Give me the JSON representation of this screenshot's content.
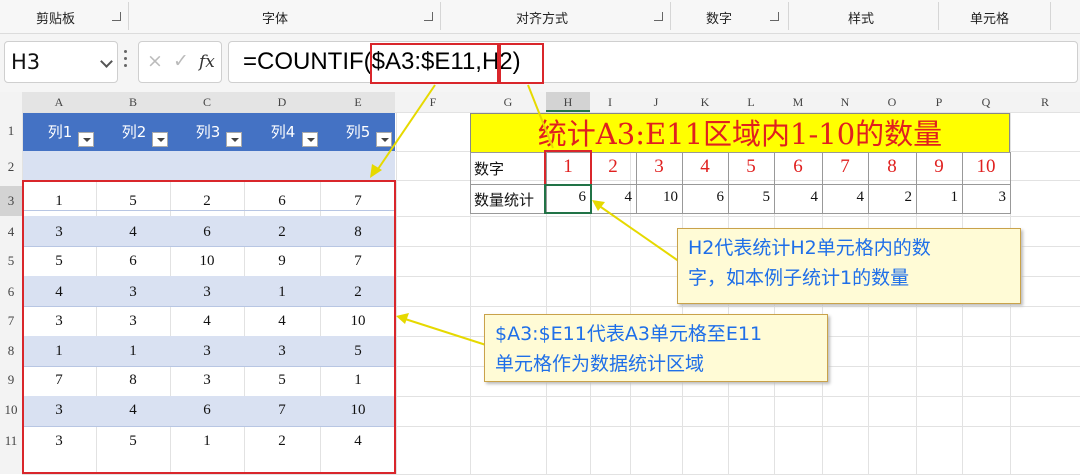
{
  "ribbon": {
    "groups": [
      "剪贴板",
      "字体",
      "对齐方式",
      "数字",
      "样式",
      "单元格"
    ]
  },
  "formula_bar": {
    "name_box": "H3",
    "cancel_icon": "×",
    "confirm_icon": "✓",
    "fx_label": "fx",
    "formula": "=COUNTIF($A3:$E11,H2)"
  },
  "columns": [
    "A",
    "B",
    "C",
    "D",
    "E",
    "F",
    "G",
    "H",
    "I",
    "J",
    "K",
    "L",
    "M",
    "N",
    "O",
    "P",
    "Q",
    "R"
  ],
  "rows": [
    "1",
    "2",
    "3",
    "4",
    "5",
    "6",
    "7",
    "8",
    "9",
    "10",
    "11"
  ],
  "table": {
    "headers": [
      "列1",
      "列2",
      "列3",
      "列4",
      "列5"
    ],
    "rows": [
      [
        "1",
        "5",
        "2",
        "6",
        "7"
      ],
      [
        "3",
        "4",
        "6",
        "2",
        "8"
      ],
      [
        "5",
        "6",
        "10",
        "9",
        "7"
      ],
      [
        "4",
        "3",
        "3",
        "1",
        "2"
      ],
      [
        "3",
        "3",
        "4",
        "4",
        "10"
      ],
      [
        "1",
        "1",
        "3",
        "3",
        "5"
      ],
      [
        "7",
        "8",
        "3",
        "5",
        "1"
      ],
      [
        "3",
        "4",
        "6",
        "7",
        "10"
      ],
      [
        "3",
        "5",
        "1",
        "2",
        "4"
      ]
    ]
  },
  "stats": {
    "title": "统计A3:E11区域内1-10的数量",
    "row1_label": "数字",
    "numbers": [
      "1",
      "2",
      "3",
      "4",
      "5",
      "6",
      "7",
      "8",
      "9",
      "10"
    ],
    "row2_label": "数量统计",
    "counts": [
      "6",
      "4",
      "10",
      "6",
      "5",
      "4",
      "4",
      "2",
      "1",
      "3"
    ]
  },
  "notes": {
    "note1_line1": "H2代表统计H2单元格内的数",
    "note1_line2": "字，如本例子统计1的数量",
    "note2_line1": "$A3:$E11代表A3单元格至E11",
    "note2_line2": "单元格作为数据统计区域"
  },
  "colors": {
    "accent_red": "#d9262b",
    "table_header": "#4472c4",
    "band": "#d9e1f2",
    "title_fill": "#ffff00",
    "note_text": "#1f6fe8"
  }
}
